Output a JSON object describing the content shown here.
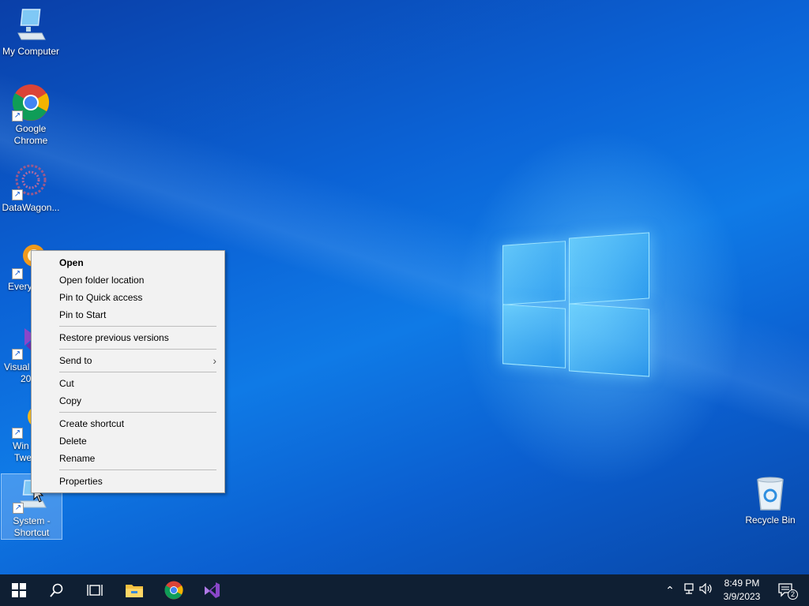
{
  "desktop": {
    "icons": [
      {
        "label": "My Computer"
      },
      {
        "label": "Google Chrome"
      },
      {
        "label": "DataWagon..."
      },
      {
        "label": "Every"
      },
      {
        "label": "Visual",
        "label2": "20"
      },
      {
        "label": "Win",
        "label2": "Twe"
      },
      {
        "label": "System - Shortcut"
      },
      {
        "label": "Recycle Bin"
      }
    ]
  },
  "context_menu": {
    "open": "Open",
    "open_folder_location": "Open folder location",
    "pin_quick_access": "Pin to Quick access",
    "pin_start": "Pin to Start",
    "restore_previous_versions": "Restore previous versions",
    "send_to": "Send to",
    "cut": "Cut",
    "copy": "Copy",
    "create_shortcut": "Create shortcut",
    "delete": "Delete",
    "rename": "Rename",
    "properties": "Properties"
  },
  "taskbar": {
    "clock_time": "8:49 PM",
    "clock_date": "3/9/2023",
    "notification_count": "2"
  },
  "colors": {
    "accent": "#0b63d6",
    "taskbar": "#0f1f33",
    "menu_bg": "#f2f2f2"
  }
}
